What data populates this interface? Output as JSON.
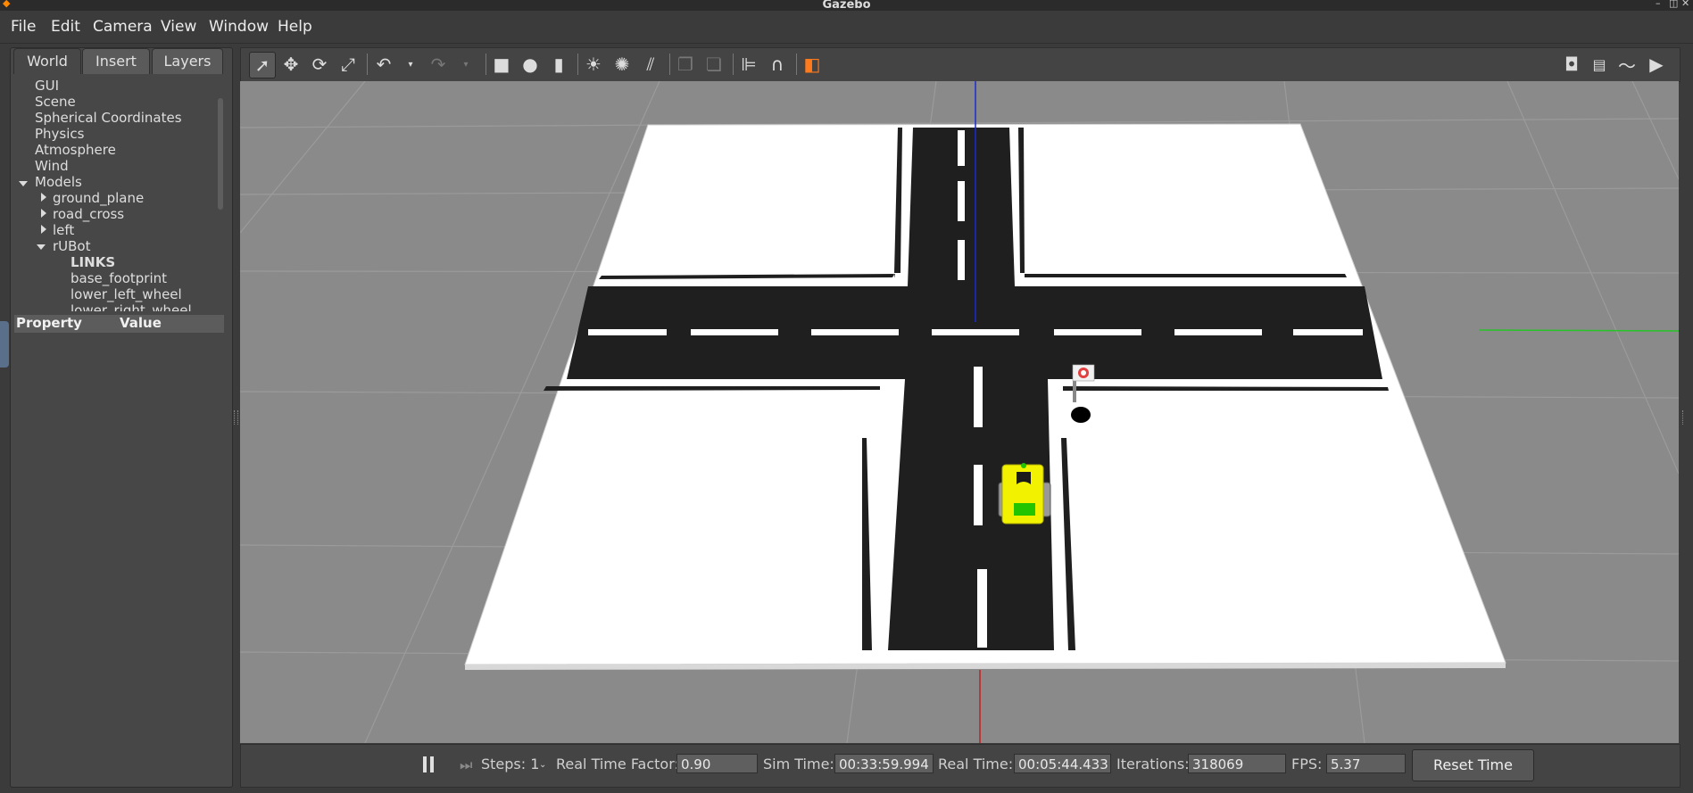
{
  "window": {
    "title": "Gazebo"
  },
  "menu": [
    "File",
    "Edit",
    "Camera",
    "View",
    "Window",
    "Help"
  ],
  "tabs": [
    "World",
    "Insert",
    "Layers"
  ],
  "tree": {
    "items": [
      "GUI",
      "Scene",
      "Spherical Coordinates",
      "Physics",
      "Atmosphere",
      "Wind"
    ],
    "models_label": "Models",
    "models": [
      "ground_plane",
      "road_cross",
      "left",
      "rUBot"
    ],
    "links_label": "LINKS",
    "links": [
      "base_footprint",
      "lower_left_wheel",
      "lower_right_wheel"
    ]
  },
  "properties": {
    "col_property": "Property",
    "col_value": "Value"
  },
  "toolbar_icons": [
    "select-arrow-icon",
    "translate-icon",
    "rotate-icon",
    "scale-icon",
    "undo-icon",
    "redo-icon",
    "box-icon",
    "sphere-icon",
    "cylinder-icon",
    "point-light-icon",
    "spot-light-icon",
    "directional-light-icon",
    "copy-icon",
    "paste-icon",
    "align-icon",
    "snap-icon",
    "view-angle-icon",
    "screenshot-icon",
    "log-icon",
    "plot-icon",
    "video-icon"
  ],
  "status": {
    "steps_label": "Steps: 1",
    "rtf_label": "Real Time Factor:",
    "rtf_value": "0.90",
    "sim_time_label": "Sim Time:",
    "sim_time_value": "00:33:59.994",
    "real_time_label": "Real Time:",
    "real_time_value": "00:05:44.433",
    "iterations_label": "Iterations:",
    "iterations_value": "318069",
    "fps_label": "FPS:",
    "fps_value": "5.37",
    "reset_label": "Reset Time"
  },
  "colors": {
    "accent_orange": "#ff7a1a",
    "robot_yellow": "#f2f200",
    "robot_green": "#22c400"
  }
}
